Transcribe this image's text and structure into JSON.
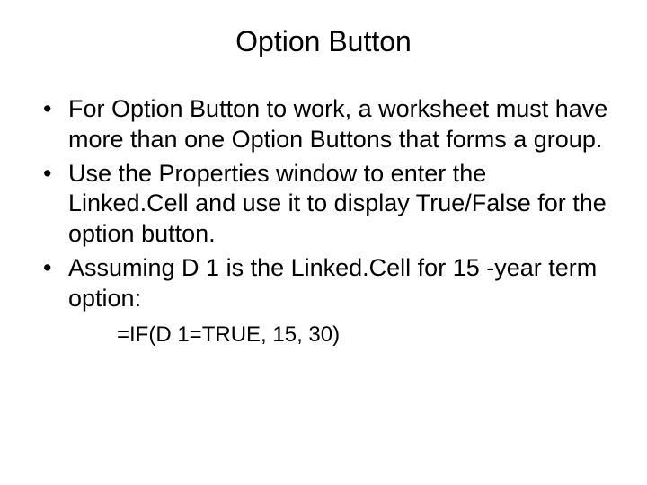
{
  "title": "Option Button",
  "bullets": [
    "For Option Button to work, a worksheet must have more than one Option Buttons that forms a group.",
    "Use the Properties window to enter the Linked.Cell and use it to display True/False for the option button.",
    "Assuming D 1 is the Linked.Cell for 15 -year term option:"
  ],
  "formula": "=IF(D 1=TRUE, 15, 30)"
}
